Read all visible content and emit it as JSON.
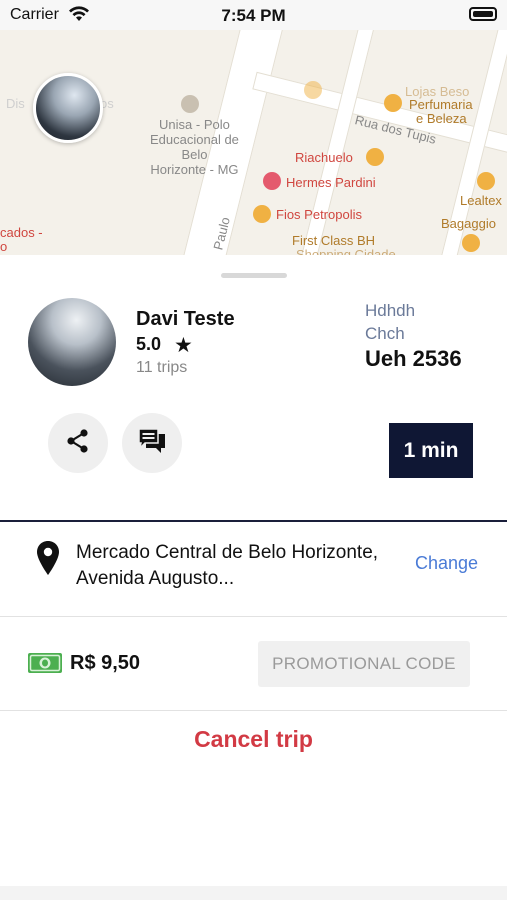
{
  "status_bar": {
    "carrier": "Carrier",
    "time": "7:54 PM"
  },
  "map": {
    "labels": {
      "unisa": "Unisa - Polo\nEducacional de\nBelo\nHorizonte - MG",
      "rua_tupis": "Rua dos Tupis",
      "riachuelo": "Riachuelo",
      "hermes": "Hermes Pardini",
      "fios": "Fios Petropolis",
      "first_class": "First Class BH",
      "shopping": "Shopping Cidade",
      "lojas": "Lojas Beso",
      "perfumaria": "Perfumaria",
      "beleza": "e Beleza",
      "lealtex": "Lealtex",
      "bagaggio": "Bagaggio",
      "paulo": "Paulo",
      "dis": "Dis",
      "os": "os",
      "cados": "cados -",
      "o": "o"
    }
  },
  "driver": {
    "name": "Davi  Teste",
    "rating": "5.0",
    "trips": "11 trips"
  },
  "vehicle": {
    "model": "Hdhdh",
    "color": "Chch",
    "plate": "Ueh 2536"
  },
  "eta": "1 min",
  "destination": {
    "address": "Mercado Central de Belo Horizonte, Avenida Augusto...",
    "change_label": "Change"
  },
  "payment": {
    "fare": "R$ 9,50",
    "promo_label": "PROMOTIONAL CODE"
  },
  "cancel_label": "Cancel trip",
  "colors": {
    "accent_navy": "#0f1734",
    "cancel_red": "#d23a44",
    "link_blue": "#4a7bd6"
  }
}
